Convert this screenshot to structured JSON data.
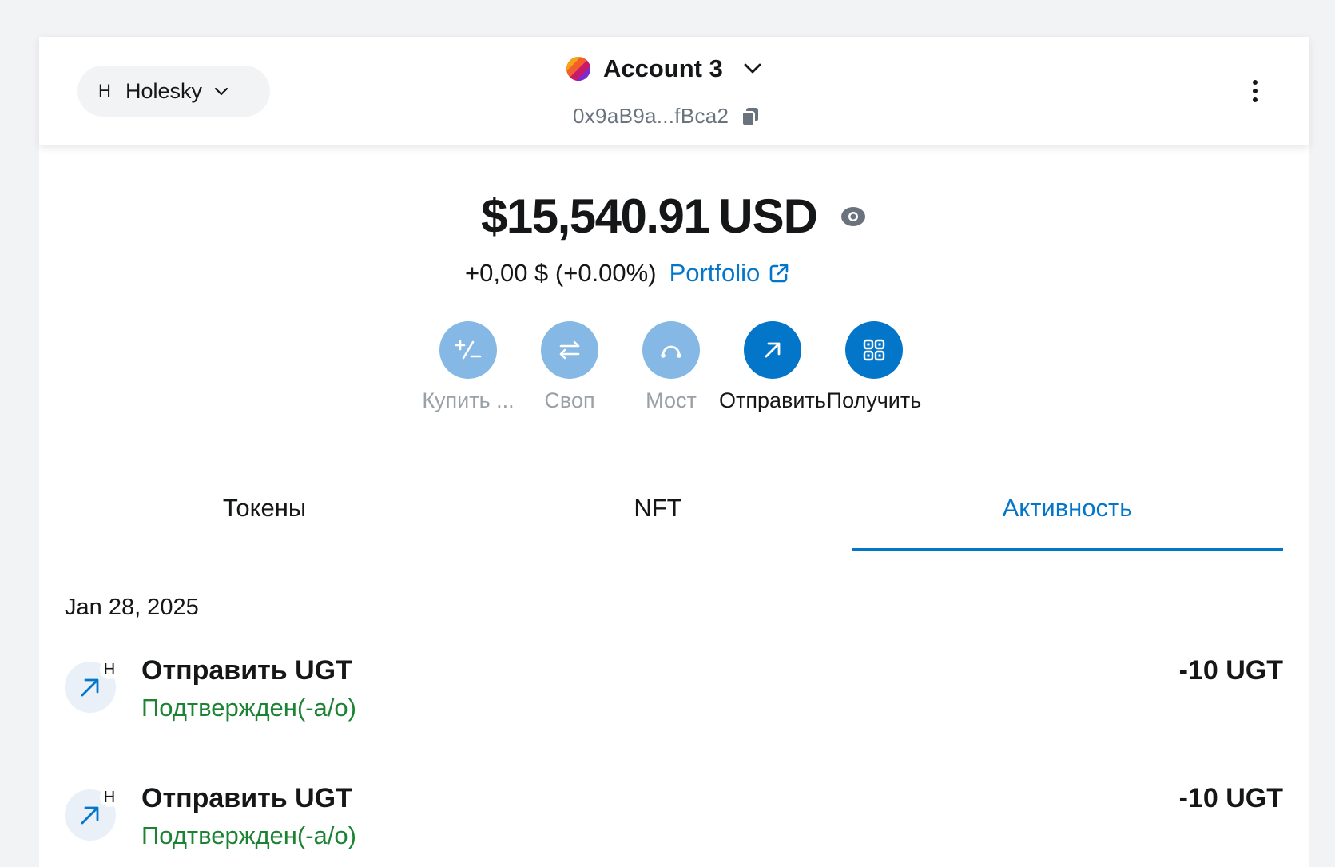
{
  "header": {
    "network": {
      "avatar_letter": "H",
      "name": "Holesky"
    },
    "account": {
      "name": "Account 3",
      "address": "0x9aB9a...fBca2"
    }
  },
  "balance": {
    "amount": "$15,540.91",
    "currency": "USD",
    "change": "+0,00 $ (+0.00%)",
    "portfolio_label": "Portfolio"
  },
  "actions": [
    {
      "label": "Купить ...",
      "icon": "buy-sell-icon",
      "enabled": false
    },
    {
      "label": "Своп",
      "icon": "swap-icon",
      "enabled": false
    },
    {
      "label": "Мост",
      "icon": "bridge-icon",
      "enabled": false
    },
    {
      "label": "Отправить",
      "icon": "send-arrow-icon",
      "enabled": true
    },
    {
      "label": "Получить",
      "icon": "qr-code-icon",
      "enabled": true
    }
  ],
  "tabs": [
    {
      "label": "Токены",
      "active": false
    },
    {
      "label": "NFT",
      "active": false
    },
    {
      "label": "Активность",
      "active": true
    }
  ],
  "activity": {
    "date": "Jan 28, 2025",
    "items": [
      {
        "title": "Отправить UGT",
        "status": "Подтвержден(-а/о)",
        "amount": "-10 UGT",
        "network_badge": "H"
      },
      {
        "title": "Отправить UGT",
        "status": "Подтвержден(-а/о)",
        "amount": "-10 UGT",
        "network_badge": "H"
      }
    ]
  },
  "colors": {
    "primary": "#0376c9",
    "primary_disabled": "#85b8e4",
    "success": "#1c8234",
    "muted": "#6a737d",
    "background": "#f2f3f5"
  }
}
